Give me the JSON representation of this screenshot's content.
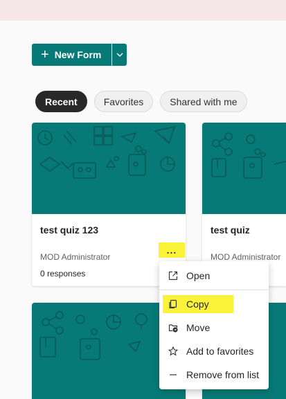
{
  "toolbar": {
    "new_form_label": "New Form"
  },
  "tabs": [
    {
      "label": "Recent",
      "active": true
    },
    {
      "label": "Favorites",
      "active": false
    },
    {
      "label": "Shared with me",
      "active": false
    }
  ],
  "cards": [
    {
      "title": "test quiz 123",
      "owner": "MOD Administrator",
      "responses": "0 responses",
      "more_label": "..."
    },
    {
      "title": "test quiz",
      "owner": "MOD Administrator"
    }
  ],
  "context_menu": {
    "items": [
      {
        "label": "Open",
        "icon": "open-in-new-icon"
      },
      {
        "label": "Copy",
        "icon": "copy-icon"
      },
      {
        "label": "Move",
        "icon": "move-icon"
      },
      {
        "label": "Add to favorites",
        "icon": "star-icon"
      },
      {
        "label": "Remove from list",
        "icon": "minus-icon"
      }
    ]
  },
  "colors": {
    "brand": "#077a77",
    "highlight": "#fbf33a",
    "active_tab": "#292929",
    "top_band": "#f6e8ea"
  }
}
